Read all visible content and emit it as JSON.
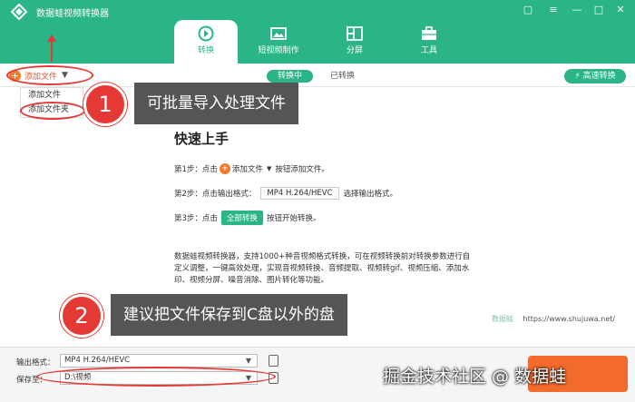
{
  "app": {
    "title": "数据蛙视频转换器"
  },
  "window_controls": [
    {
      "name": "feedback-icon",
      "glyph": "▢"
    },
    {
      "name": "menu-icon",
      "glyph": "≡"
    },
    {
      "name": "minimize-icon",
      "glyph": "—"
    },
    {
      "name": "maximize-icon",
      "glyph": "□"
    },
    {
      "name": "close-icon",
      "glyph": "✕"
    }
  ],
  "tabs": [
    {
      "label": "转换",
      "icon": "convert-icon"
    },
    {
      "label": "短视频制作",
      "icon": "mv-icon"
    },
    {
      "label": "分屏",
      "icon": "split-screen-icon"
    },
    {
      "label": "工具",
      "icon": "toolbox-icon"
    }
  ],
  "toolbar": {
    "add_file_label": "添加文件",
    "segment_active": "转换中",
    "segment_inactive": "已转换",
    "fast_convert_label": "高速转换"
  },
  "dropdown": {
    "items": [
      "添加文件",
      "添加文件夹"
    ]
  },
  "guide": {
    "title": "快速上手",
    "step1": {
      "prefix": "第1步：点击",
      "btn": "添加文件",
      "suffix": "按钮添加文件。"
    },
    "step2": {
      "prefix": "第2步：点击输出格式：",
      "tag": "MP4 H.264/HEVC",
      "suffix": "选择输出格式。"
    },
    "step3": {
      "prefix": "第3步：点击",
      "btn": "全部转换",
      "suffix": "按钮开始转换。"
    },
    "description": "数据蛙视频转换器，支持1000+种音视频格式转换，可在视频转换前对转换参数进行自定义调整，一键高效处理，实现音视频转换、音频提取、视频转gif、视频压缩、添加水印、视频分屏、噪音消除、图片转化等功能。",
    "site_brand": "数据蛙",
    "site_url": "https://www.shujuwa.net/"
  },
  "bottom": {
    "format_label": "输出格式：",
    "format_value": "MP4 H.264/HEVC",
    "save_label": "保存至：",
    "save_value": "D:\\视频"
  },
  "annotations": {
    "callout1_num": "1",
    "callout1_text": "可批量导入处理文件",
    "callout2_num": "2",
    "callout2_text": "建议把文件保存到C盘以外的盘"
  },
  "watermark": "掘金技术社区 @ 数据蛙",
  "colors": {
    "brand": "#2bb586",
    "accent": "#f07a2a",
    "annotation": "#e53935"
  }
}
